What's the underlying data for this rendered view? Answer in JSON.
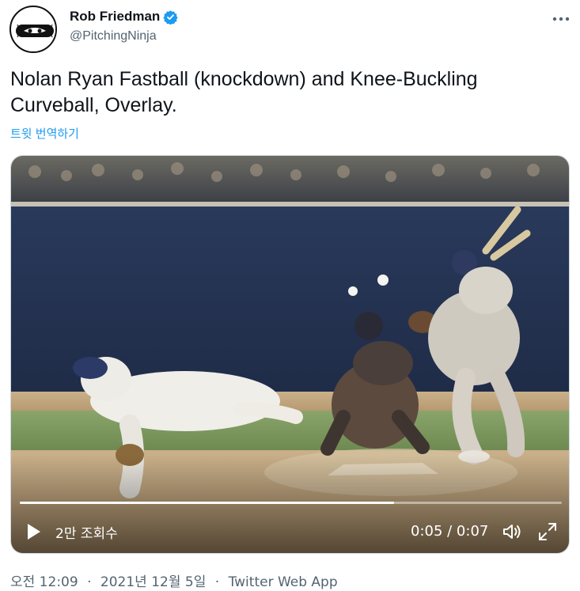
{
  "author": {
    "name": "Rob Friedman",
    "handle": "@PitchingNinja",
    "verified_icon": "verified-badge-icon",
    "avatar_icon": "ninja-baseball-avatar"
  },
  "tweet": {
    "text": "Nolan Ryan Fastball (knockdown) and Knee-Buckling Curveball, Overlay.",
    "translate_label": "트윗 번역하기"
  },
  "video": {
    "views": "2만 조회수",
    "time": "0:05 / 0:07",
    "progress": 0.69,
    "play_icon": "play-icon",
    "volume_icon": "volume-icon",
    "fullscreen_icon": "fullscreen-icon"
  },
  "meta": {
    "time": "오전 12:09",
    "separator": "·",
    "date": "2021년 12월 5일",
    "source": "Twitter Web App"
  },
  "colors": {
    "accent": "#1d9bf0",
    "text": "#0f1419",
    "secondary": "#536471"
  },
  "more_icon": "more-dots-icon"
}
